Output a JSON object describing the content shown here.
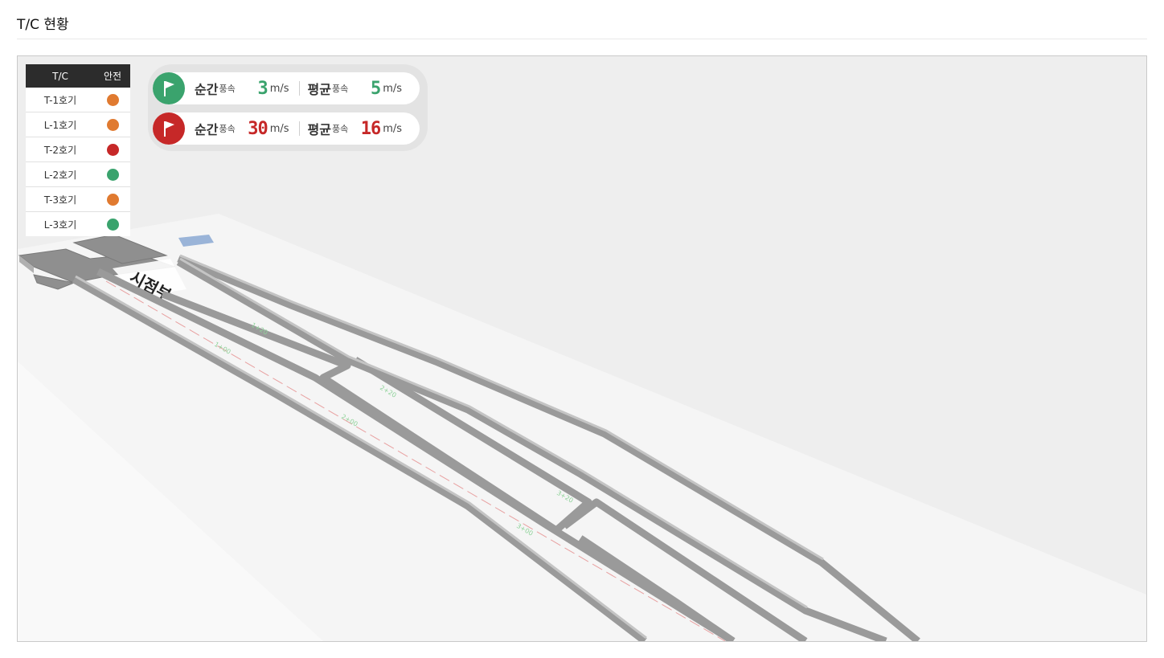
{
  "page": {
    "title": "T/C 현황"
  },
  "table": {
    "headers": [
      "T/C",
      "안전"
    ],
    "rows": [
      {
        "name": "T-1호기",
        "status_color": "#e07a30"
      },
      {
        "name": "L-1호기",
        "status_color": "#e07a30"
      },
      {
        "name": "T-2호기",
        "status_color": "#c62828"
      },
      {
        "name": "L-2호기",
        "status_color": "#3aa36d"
      },
      {
        "name": "T-3호기",
        "status_color": "#e07a30"
      },
      {
        "name": "L-3호기",
        "status_color": "#3aa36d"
      }
    ]
  },
  "wind": [
    {
      "flag_icon": "flag-icon",
      "flag_color": "#3aa36d",
      "value_color": "#3aa36d",
      "instant_label": "순간",
      "instant_sub": "풍속",
      "instant_value": "3",
      "instant_unit": "m/s",
      "avg_label": "평균",
      "avg_sub": "풍속",
      "avg_value": "5",
      "avg_unit": "m/s"
    },
    {
      "flag_icon": "flag-icon",
      "flag_color": "#c62828",
      "value_color": "#c62828",
      "instant_label": "순간",
      "instant_sub": "풍속",
      "instant_value": "30",
      "instant_unit": "m/s",
      "avg_label": "평균",
      "avg_sub": "풍속",
      "avg_value": "16",
      "avg_unit": "m/s"
    }
  ]
}
